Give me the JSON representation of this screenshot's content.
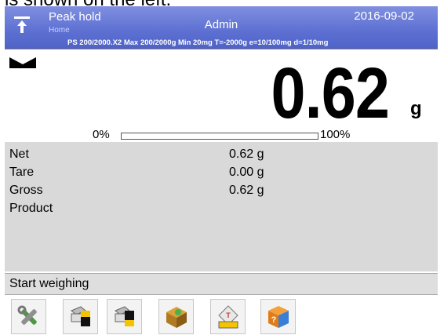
{
  "crop_text": "is shown on the left.",
  "header": {
    "mode_title": "Peak hold",
    "mode_subtitle": "Home",
    "user": "Admin",
    "date": "2016-09-02",
    "spec_line": "PS 200/2000.X2  Max 200/2000g  Min 20mg  T=-2000g  e=10/100mg  d=1/10mg",
    "icons": {
      "logo": "scale-icon"
    }
  },
  "display": {
    "value": "0.62",
    "unit": "g",
    "stability_icon": "stable-icon",
    "bar": {
      "min_label": "0%",
      "max_label": "100%",
      "fill_fraction": 0.0
    }
  },
  "info": {
    "rows": [
      {
        "label": "Net",
        "value": "0.62 g"
      },
      {
        "label": "Tare",
        "value": "0.00 g"
      },
      {
        "label": "Gross",
        "value": "0.62 g"
      },
      {
        "label": "Product",
        "value": ""
      }
    ]
  },
  "status": {
    "text": "Start weighing"
  },
  "toolbar": {
    "buttons": [
      {
        "icon": "tools-icon"
      },
      {
        "icon": "print-header-icon"
      },
      {
        "icon": "print-footer-icon"
      },
      {
        "icon": "product-box-icon"
      },
      {
        "icon": "tare-database-icon"
      },
      {
        "icon": "help-icon"
      }
    ]
  },
  "colors": {
    "header": "#5d70d2",
    "info_bg": "#d9d9d9",
    "status_bg": "#dedede"
  }
}
